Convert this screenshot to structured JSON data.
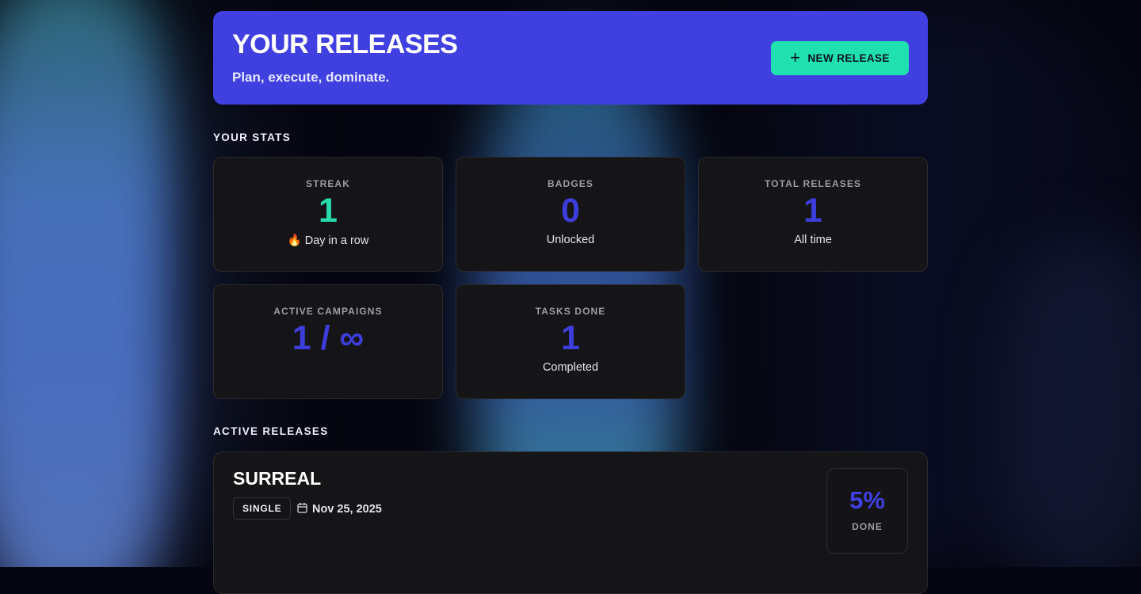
{
  "hero": {
    "title": "YOUR RELEASES",
    "subtitle": "Plan, execute, dominate.",
    "new_release_label": "NEW RELEASE",
    "new_release_icon": "plus-icon"
  },
  "colors": {
    "accent": "#4040e0",
    "mint": "#20e0b0",
    "card_bg": "#151517"
  },
  "stats": {
    "title": "YOUR STATS",
    "cards": [
      {
        "label": "STREAK",
        "value": "1",
        "foot": "🔥 Day in a row",
        "color": "green"
      },
      {
        "label": "BADGES",
        "value": "0",
        "foot": "Unlocked"
      },
      {
        "label": "TOTAL RELEASES",
        "value": "1",
        "foot": "All time"
      },
      {
        "label": "ACTIVE CAMPAIGNS",
        "value": "1 / ∞",
        "foot": ""
      },
      {
        "label": "TASKS DONE",
        "value": "1",
        "foot": "Completed"
      }
    ]
  },
  "active": {
    "title": "ACTIVE RELEASES",
    "releases": [
      {
        "name": "SURREAL",
        "type": "SINGLE",
        "date": "Nov 25, 2025",
        "date_icon": "calendar-icon",
        "progress_text": "5%",
        "progress_label": "DONE"
      }
    ]
  }
}
